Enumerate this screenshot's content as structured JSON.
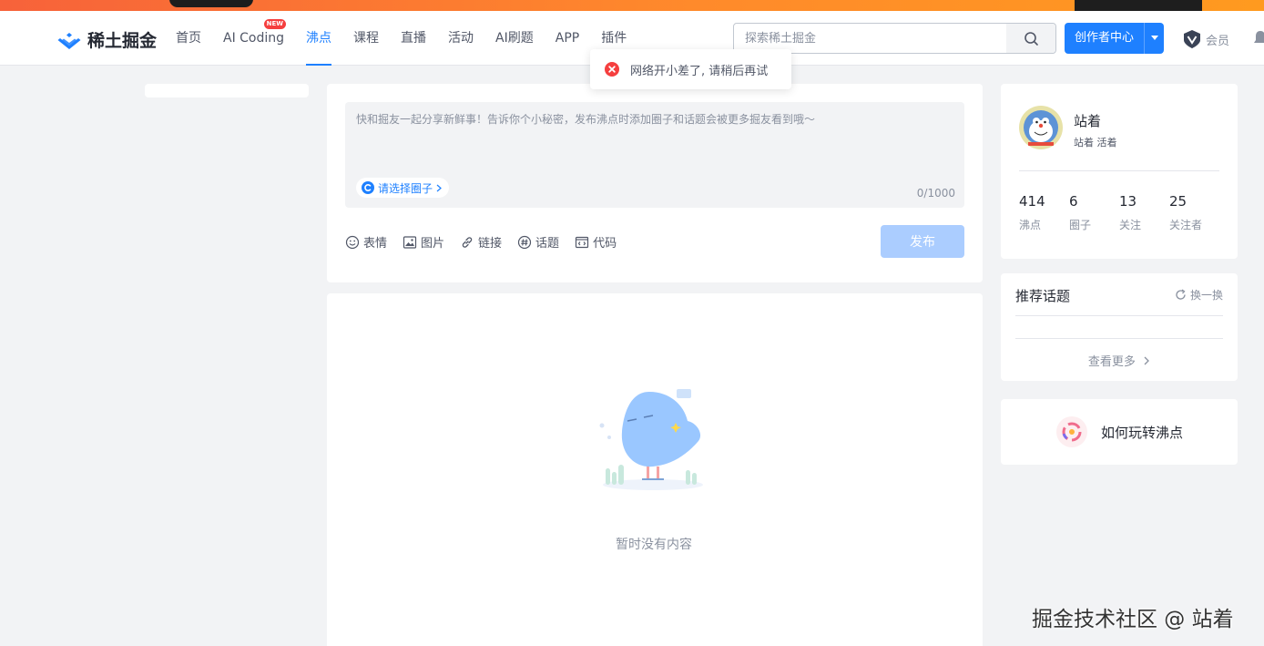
{
  "header": {
    "logo_text": "稀土掘金",
    "nav": [
      {
        "label": "首页"
      },
      {
        "label": "AI Coding",
        "badge": "NEW"
      },
      {
        "label": "沸点",
        "active": true
      },
      {
        "label": "课程"
      },
      {
        "label": "直播"
      },
      {
        "label": "活动"
      },
      {
        "label": "AI刷题"
      },
      {
        "label": "APP"
      },
      {
        "label": "插件"
      }
    ],
    "search_placeholder": "探索稀土掘金",
    "creator_label": "创作者中心",
    "member_label": "会员"
  },
  "toast": {
    "message": "网络开小差了, 请稍后再试"
  },
  "publisher": {
    "placeholder": "快和掘友一起分享新鲜事！告诉你个小秘密，发布沸点时添加圈子和话题会被更多掘友看到哦～",
    "circle_label": "请选择圈子",
    "counter": "0/1000",
    "tools": {
      "emoji": "表情",
      "image": "图片",
      "link": "链接",
      "topic": "话题",
      "code": "代码"
    },
    "publish_label": "发布"
  },
  "feed": {
    "empty_text": "暂时没有内容"
  },
  "profile": {
    "name": "站着",
    "subtitle": "站着 活着",
    "stats": [
      {
        "value": "414",
        "label": "沸点"
      },
      {
        "value": "6",
        "label": "圈子"
      },
      {
        "value": "13",
        "label": "关注"
      },
      {
        "value": "25",
        "label": "关注者"
      }
    ]
  },
  "topics": {
    "title": "推荐话题",
    "refresh_label": "换一换",
    "more_label": "查看更多"
  },
  "howto": {
    "label": "如何玩转沸点"
  },
  "watermark": "掘金技术社区 @ 站着",
  "colors": {
    "accent": "#1e80ff",
    "error": "#f53f3f",
    "text": "#252933",
    "muted": "#8a919f",
    "background": "#f2f3f5"
  }
}
